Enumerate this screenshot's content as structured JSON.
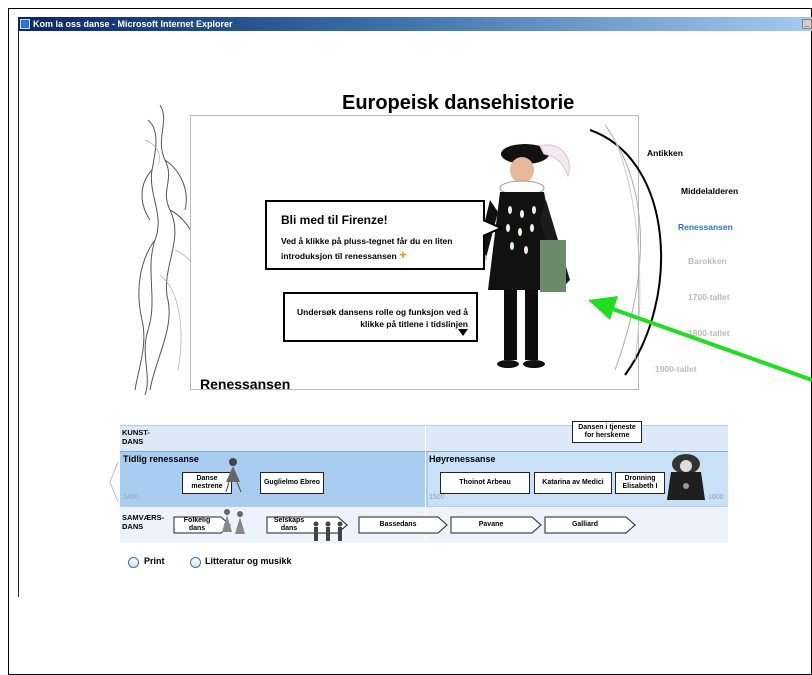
{
  "window": {
    "title": "Kom la oss danse - Microsoft Internet Explorer"
  },
  "page": {
    "title": "Europeisk dansehistorie",
    "section": "Renessansen"
  },
  "intro_bubble": {
    "title": "Bli med til Firenze!",
    "text": "Ved å klikke på pluss-tegnet får du en liten introduksjon til renessansen",
    "plus": "+"
  },
  "hint_bubble": {
    "text": "Undersøk dansens rolle og funksjon ved å klikke på titlene i tidslinjen"
  },
  "eras": [
    {
      "label": "Antikken",
      "color": "#000000"
    },
    {
      "label": "Middelalderen",
      "color": "#000000"
    },
    {
      "label": "Renessansen",
      "color": "#2a6fd6"
    },
    {
      "label": "Barokken",
      "color": "#bbbbbb"
    },
    {
      "label": "1700-tallet",
      "color": "#bbbbbb"
    },
    {
      "label": "1800-tallet",
      "color": "#bbbbbb"
    },
    {
      "label": "1900-tallet",
      "color": "#bbbbbb"
    }
  ],
  "timeline": {
    "row_kunstdans": "KUNST-\nDANS",
    "row_samvaersdans": "SAMVÆRS-\nDANS",
    "early_label": "Tidlig renessanse",
    "high_label": "Høyrenessanse",
    "years": [
      "1400",
      "1500",
      "1600"
    ],
    "top_box": "Dansen i tjeneste\nfor herskerne",
    "kunst_items": [
      "Danse\nmestrene",
      "Guglielmo Ebreo",
      "Thoinot Arbeau",
      "Katarina av Medici",
      "Dronning\nElisabeth I"
    ],
    "samvaer_items": [
      "Folkelig\ndans",
      "Selskaps\ndans",
      "Bassedans",
      "Pavane",
      "Galliard"
    ]
  },
  "options": {
    "print": "Print",
    "literature": "Litteratur og musikk"
  },
  "colors": {
    "accent_arrow": "#22dd22",
    "plus": "#f58a1f",
    "timeline_blue": "#a9cdf0"
  }
}
